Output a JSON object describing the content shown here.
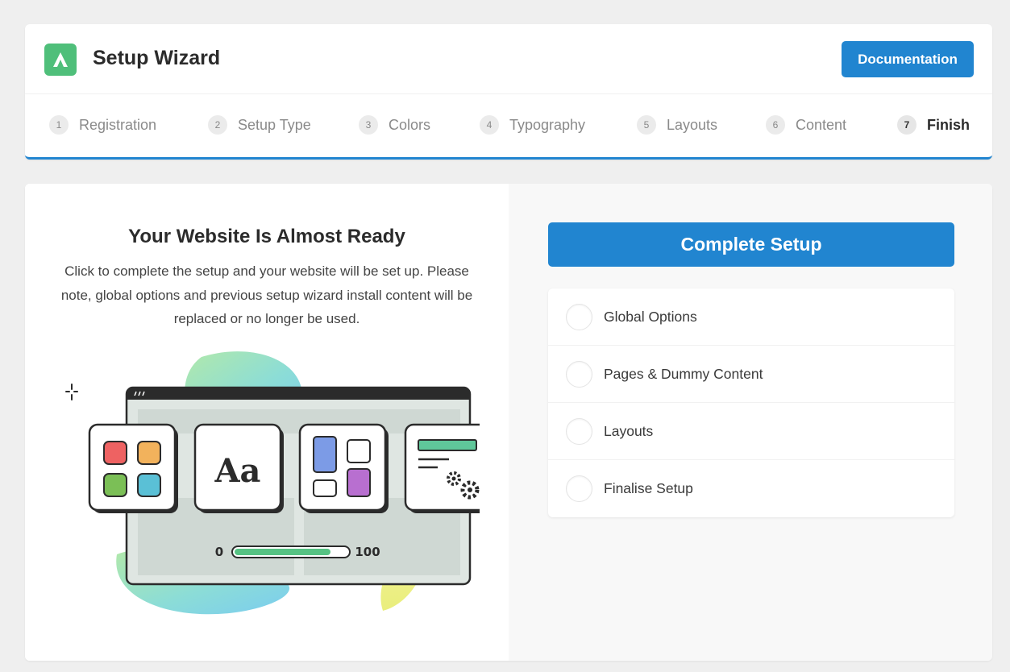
{
  "header": {
    "title": "Setup Wizard",
    "documentation_label": "Documentation"
  },
  "steps": [
    {
      "num": "1",
      "label": "Registration"
    },
    {
      "num": "2",
      "label": "Setup Type"
    },
    {
      "num": "3",
      "label": "Colors"
    },
    {
      "num": "4",
      "label": "Typography"
    },
    {
      "num": "5",
      "label": "Layouts"
    },
    {
      "num": "6",
      "label": "Content"
    },
    {
      "num": "7",
      "label": "Finish"
    }
  ],
  "main": {
    "heading": "Your Website Is Almost Ready",
    "description": "Click to complete the setup and your website will be set up. Please note, global options and previous setup wizard install content will be replaced or no longer be used.",
    "illustration": {
      "font_sample": "Aa",
      "progress_min": "0",
      "progress_max": "100",
      "progress_value_percent": 85
    },
    "complete_label": "Complete Setup",
    "tasks": [
      {
        "label": "Global Options"
      },
      {
        "label": "Pages & Dummy Content"
      },
      {
        "label": "Layouts"
      },
      {
        "label": "Finalise Setup"
      }
    ]
  },
  "colors": {
    "accent": "#2185d0",
    "logo": "#4fbf7a",
    "background": "#efefef"
  }
}
